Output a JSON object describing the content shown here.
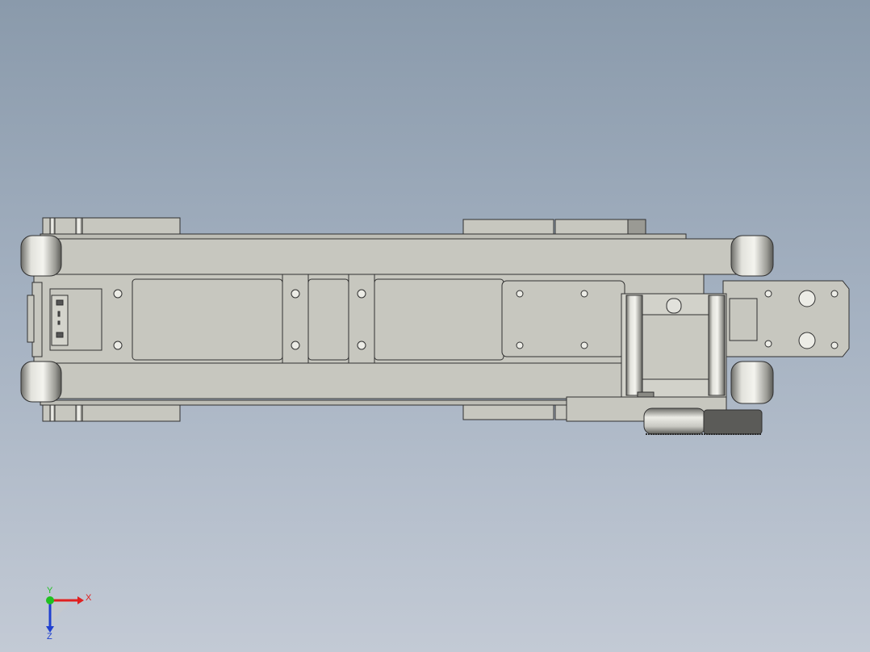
{
  "viewport": {
    "background_top": "#8a9aab",
    "background_bottom": "#c3cad5",
    "part_color": "#c7c7bf",
    "edge_color": "#303030"
  },
  "triad": {
    "x_label": "X",
    "y_label": "Y",
    "z_label": "Z",
    "x_color": "#e02020",
    "y_color": "#20c020",
    "z_color": "#2040d0"
  }
}
